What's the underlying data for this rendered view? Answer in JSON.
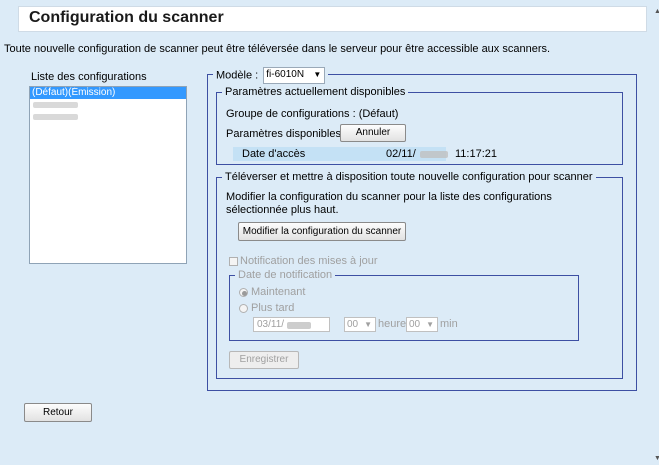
{
  "page": {
    "title": "Configuration du scanner",
    "description": "Toute nouvelle configuration de scanner peut être téléversée dans le serveur pour être accessible aux scanners."
  },
  "config_list": {
    "label": "Liste des configurations",
    "items": [
      {
        "label": "(Défaut)(Émission)",
        "selected": true
      },
      {
        "label": "",
        "selected": false
      },
      {
        "label": "",
        "selected": false
      }
    ]
  },
  "model": {
    "label": "Modèle :",
    "value": "fi-6010N"
  },
  "current_params": {
    "legend": "Paramètres actuellement disponibles",
    "group_label": "Groupe de configurations : (Défaut)",
    "available_label": "Paramètres disponibles",
    "cancel_button": "Annuler",
    "access_date_label": "Date d'accès",
    "access_date_value": "02/11/",
    "access_time_value": "11:17:21"
  },
  "upload": {
    "legend": "Téléverser et mettre à disposition toute nouvelle configuration pour scanner",
    "text": "Modifier la configuration du scanner pour la liste des configurations sélectionnée plus haut.",
    "modify_button": "Modifier la configuration du scanner",
    "notify_checkbox": "Notification des mises à jour",
    "notification": {
      "legend": "Date de notification",
      "now_label": "Maintenant",
      "later_label": "Plus tard",
      "date_value": "03/11/",
      "hour_value": "00",
      "hour_label": "heure",
      "min_value": "00",
      "min_label": "min"
    },
    "save_button": "Enregistrer"
  },
  "footer": {
    "back_button": "Retour"
  }
}
